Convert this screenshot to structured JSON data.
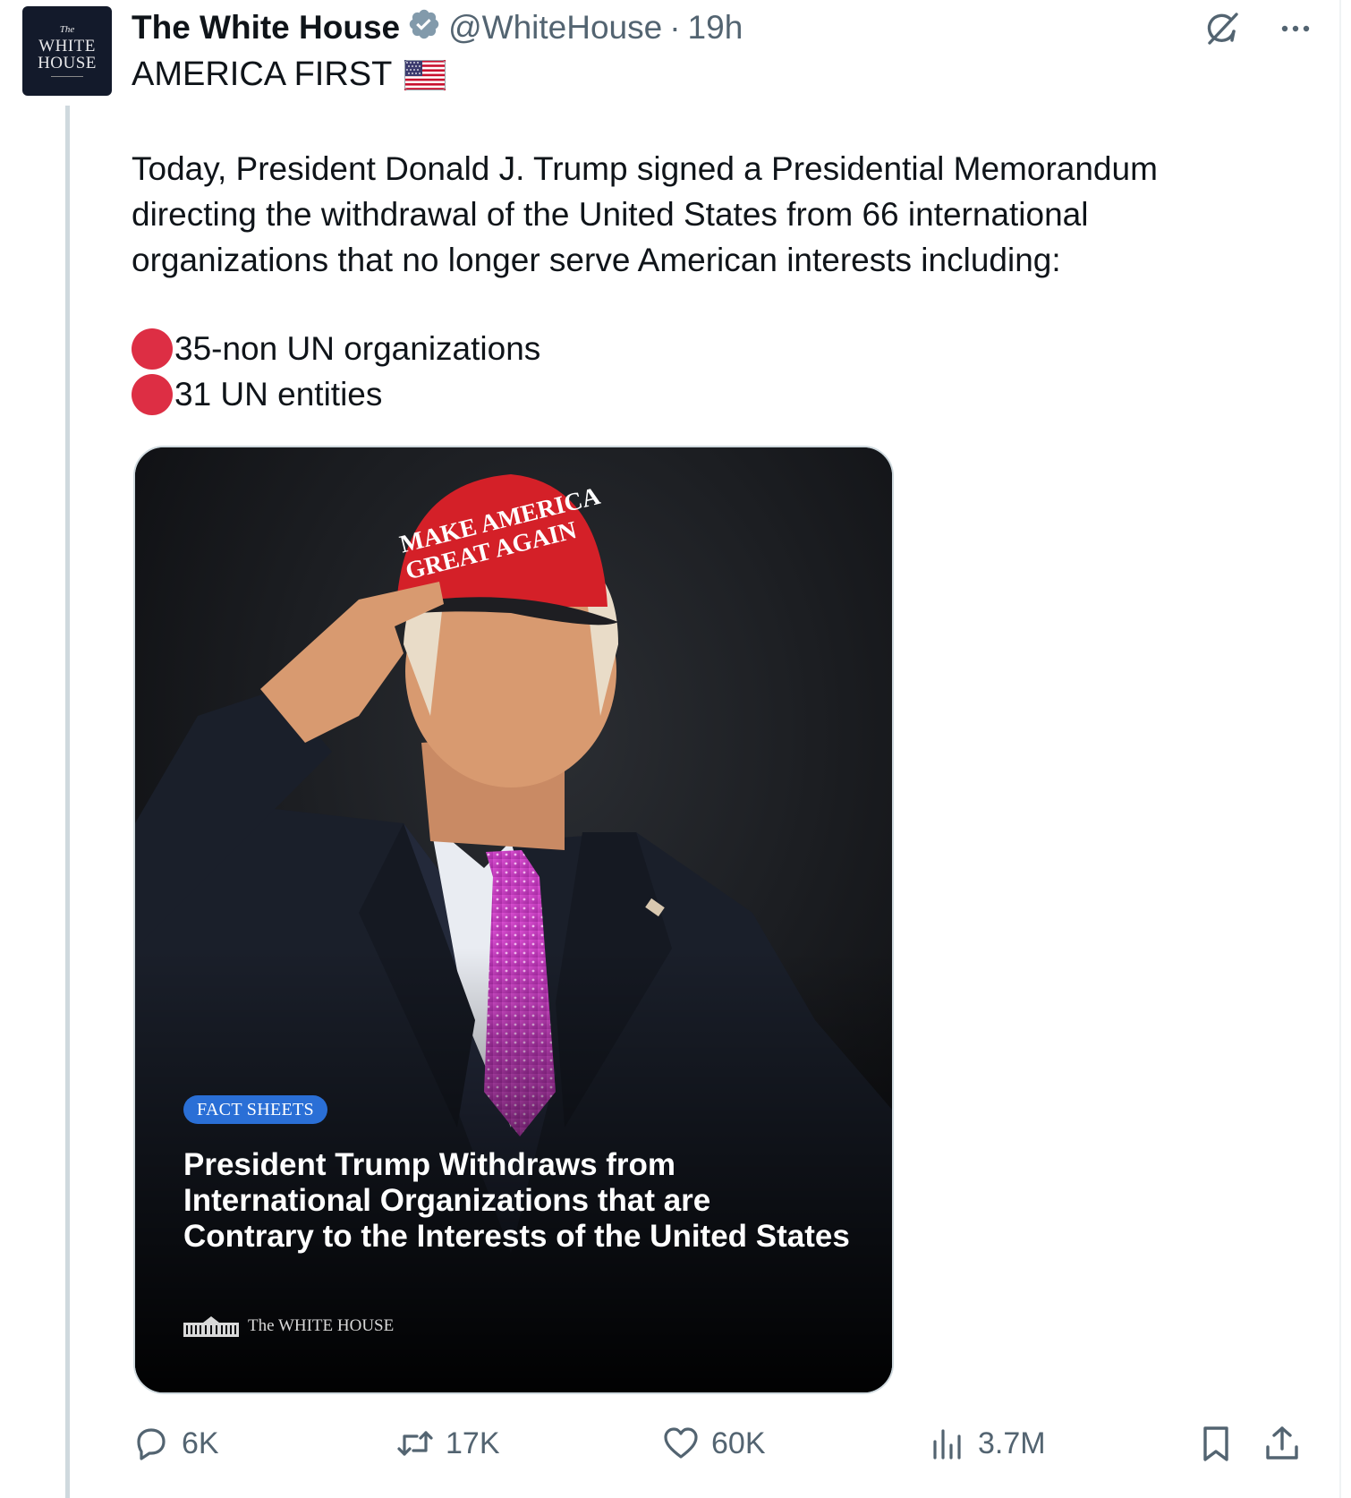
{
  "account": {
    "display_name": "The White House",
    "handle": "@WhiteHouse",
    "separator": "·",
    "timestamp": "19h",
    "avatar_text": {
      "top": "The",
      "line1": "WHITE",
      "line2": "HOUSE"
    }
  },
  "post": {
    "subtitle": "AMERICA FIRST",
    "body_lines": [
      "Today, President Donald J. Trump signed a Presidential Memorandum",
      "directing the withdrawal of the United States from 66 international",
      "organizations that no longer serve American interests including:"
    ],
    "list_items": [
      "35-non UN organizations",
      "31 UN entities"
    ]
  },
  "media": {
    "badge": "FACT SHEETS",
    "headline_lines": [
      "President Trump Withdraws from",
      "International Organizations that are",
      "Contrary to the Interests of the United States"
    ],
    "footer_brand": "The WHITE HOUSE",
    "hat_text_line1": "MAKE AMERICA",
    "hat_text_line2": "GREAT AGAIN"
  },
  "actions": {
    "replies": "6K",
    "reposts": "17K",
    "likes": "60K",
    "views": "3.7M"
  },
  "icons": {
    "verified": "verified-badge-icon",
    "grok": "grok-icon",
    "more": "more-options-icon",
    "flag": "us-flag-icon",
    "reply": "reply-icon",
    "repost": "repost-icon",
    "like": "heart-icon",
    "views": "views-chart-icon",
    "bookmark": "bookmark-icon",
    "share": "share-icon"
  },
  "colors": {
    "text": "#0f1419",
    "muted": "#536471",
    "list_dot": "#dd2e44",
    "badge_blue": "#2a6fd6",
    "hat_red": "#d42028",
    "tie_magenta": "#c43bbf"
  }
}
